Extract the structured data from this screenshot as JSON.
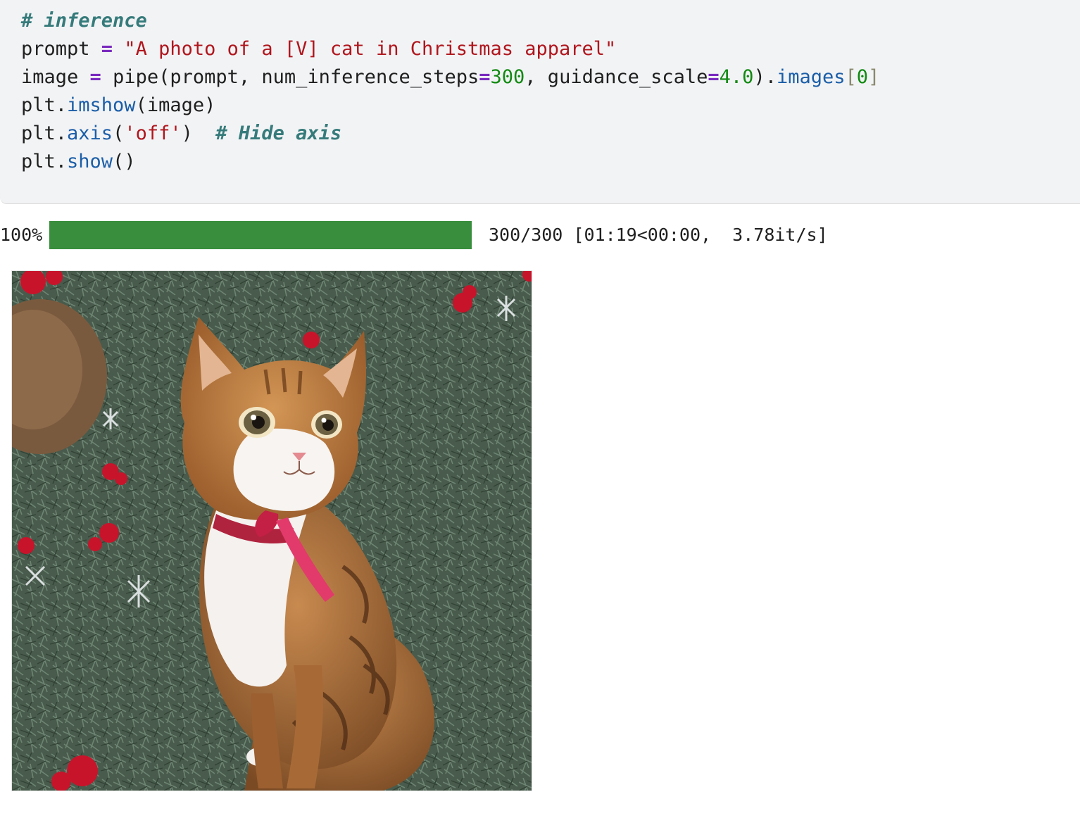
{
  "code_cell": {
    "lines": [
      [
        {
          "t": "# inference",
          "c": "comment"
        }
      ],
      [
        {
          "t": "prompt ",
          "c": "plain"
        },
        {
          "t": "=",
          "c": "op"
        },
        {
          "t": " ",
          "c": "plain"
        },
        {
          "t": "\"A photo of a [V] cat in Christmas apparel\"",
          "c": "str"
        }
      ],
      [
        {
          "t": "image ",
          "c": "plain"
        },
        {
          "t": "=",
          "c": "op"
        },
        {
          "t": " pipe(prompt, num_inference_steps",
          "c": "plain"
        },
        {
          "t": "=",
          "c": "op"
        },
        {
          "t": "300",
          "c": "num"
        },
        {
          "t": ", guidance_scale",
          "c": "plain"
        },
        {
          "t": "=",
          "c": "op"
        },
        {
          "t": "4.0",
          "c": "num"
        },
        {
          "t": ").",
          "c": "plain"
        },
        {
          "t": "images",
          "c": "attr"
        },
        {
          "t": "[",
          "c": "bracket"
        },
        {
          "t": "0",
          "c": "num"
        },
        {
          "t": "]",
          "c": "bracket"
        }
      ],
      [
        {
          "t": "plt.",
          "c": "plain"
        },
        {
          "t": "imshow",
          "c": "attr"
        },
        {
          "t": "(image)",
          "c": "plain"
        }
      ],
      [
        {
          "t": "plt.",
          "c": "plain"
        },
        {
          "t": "axis",
          "c": "attr"
        },
        {
          "t": "(",
          "c": "plain"
        },
        {
          "t": "'off'",
          "c": "str"
        },
        {
          "t": ")  ",
          "c": "plain"
        },
        {
          "t": "# Hide axis",
          "c": "comment"
        }
      ],
      [
        {
          "t": "plt.",
          "c": "plain"
        },
        {
          "t": "show",
          "c": "attr"
        },
        {
          "t": "()",
          "c": "plain"
        }
      ]
    ]
  },
  "progress": {
    "percent_label": "100%",
    "fraction": 1.0,
    "bar_color": "#388e3c",
    "stats": "300/300 [01:19<00:00,  3.78it/s]"
  },
  "output": {
    "image_kind": "generated-cat-photo",
    "colors": {
      "foliage": "#4f6152",
      "fur": "#b5773f",
      "chest": "#f4f1ee",
      "ribbon": "#e23a6b",
      "ornament": "#c8142b"
    }
  }
}
